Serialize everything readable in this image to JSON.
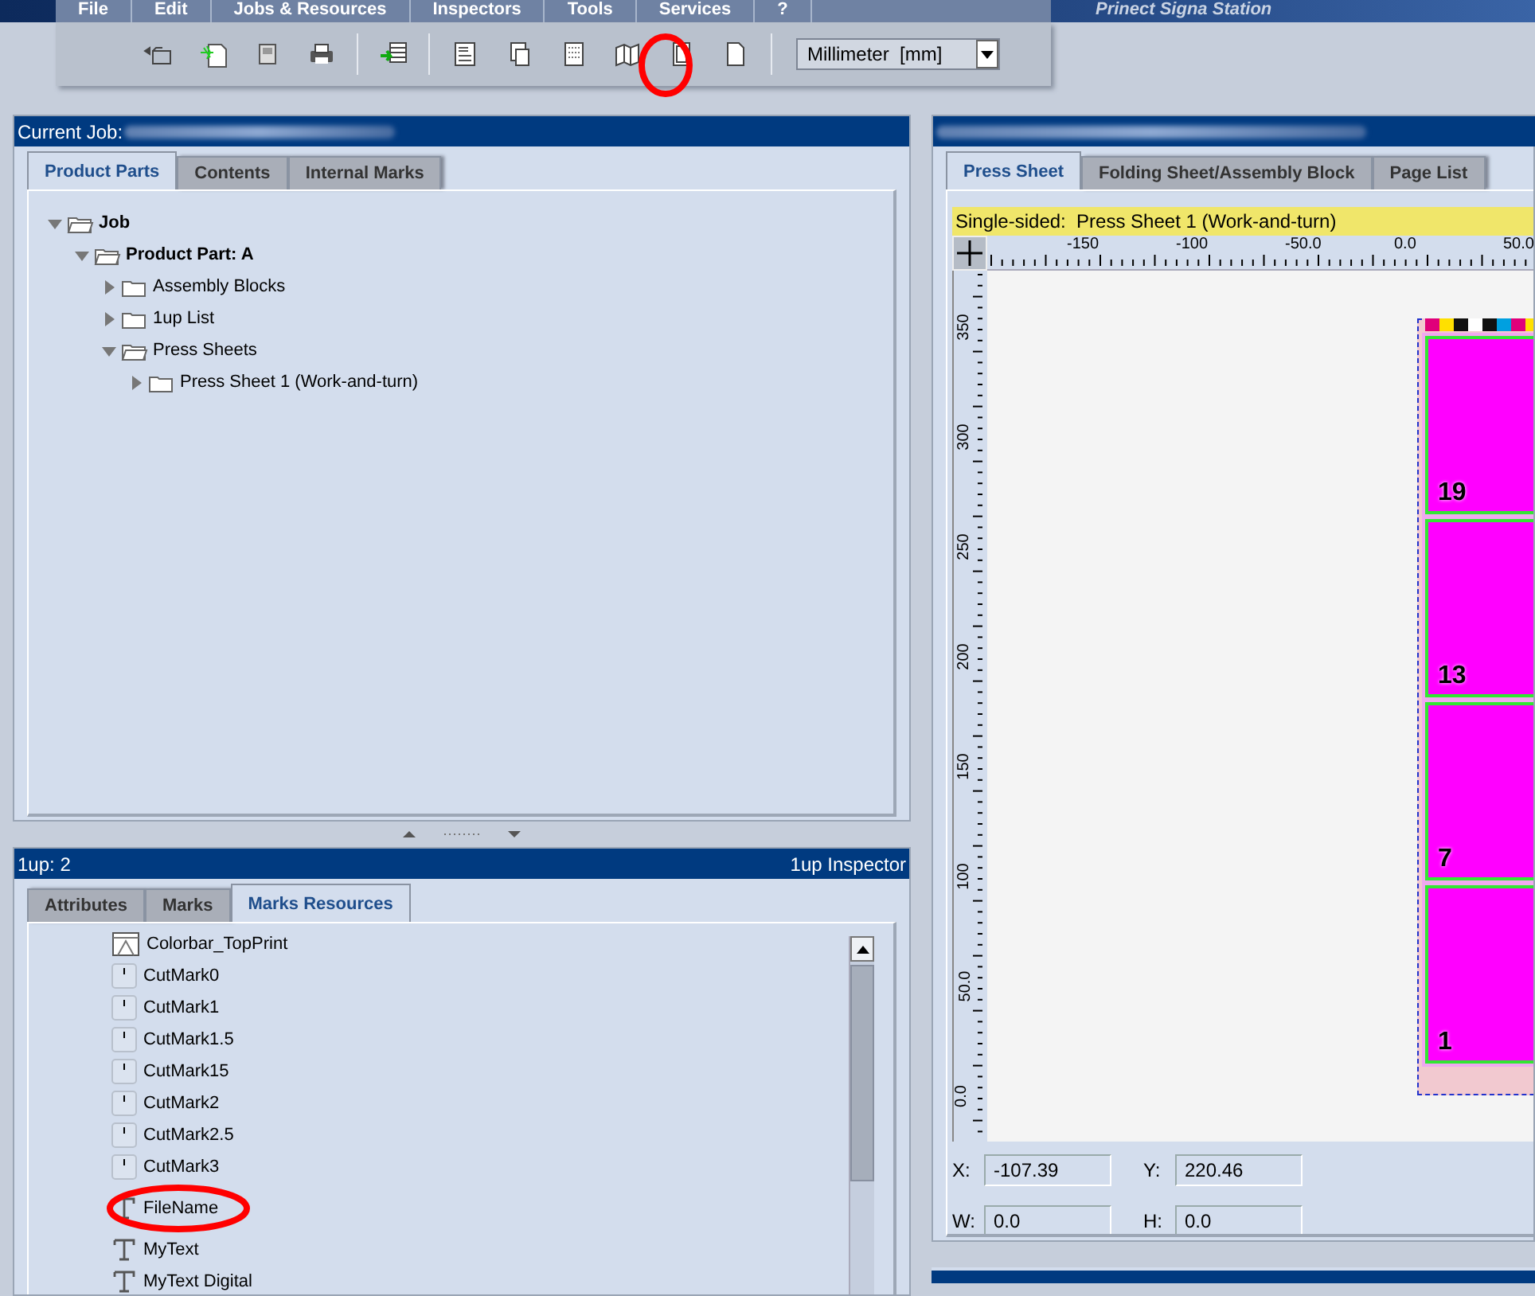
{
  "menu": [
    "File",
    "Edit",
    "Jobs & Resources",
    "Inspectors",
    "Tools",
    "Services",
    "?"
  ],
  "app_title": "Prinect Signa Station",
  "unit_select": {
    "value": "Millimeter  [mm]"
  },
  "job_panel": {
    "title": "Current Job:",
    "tabs": [
      {
        "label": "Product Parts",
        "selected": true
      },
      {
        "label": "Contents",
        "selected": false
      },
      {
        "label": "Internal Marks",
        "selected": false
      }
    ],
    "tree": [
      {
        "label": "Job",
        "kind": "node",
        "expanded": true,
        "children": [
          {
            "label": "Product Part: A",
            "kind": "node",
            "expanded": true,
            "children": [
              {
                "label": "Assembly Blocks",
                "kind": "folder",
                "expanded": false
              },
              {
                "label": "1up List",
                "kind": "folder",
                "expanded": false
              },
              {
                "label": "Press Sheets",
                "kind": "folder",
                "expanded": true,
                "children": [
                  {
                    "label": "Press Sheet 1 (Work-and-turn)",
                    "kind": "folder",
                    "expanded": false
                  }
                ]
              }
            ]
          }
        ]
      }
    ]
  },
  "inspector_panel": {
    "title": "1up: 2",
    "title_right": "1up Inspector",
    "tabs": [
      {
        "label": "Attributes",
        "selected": false
      },
      {
        "label": "Marks",
        "selected": false
      },
      {
        "label": "Marks Resources",
        "selected": true
      }
    ],
    "items": [
      {
        "kind": "colorbar",
        "label": "Colorbar_TopPrint"
      },
      {
        "kind": "cutmark",
        "label": "CutMark0"
      },
      {
        "kind": "cutmark",
        "label": "CutMark1"
      },
      {
        "kind": "cutmark",
        "label": "CutMark1.5"
      },
      {
        "kind": "cutmark",
        "label": "CutMark15"
      },
      {
        "kind": "cutmark",
        "label": "CutMark2"
      },
      {
        "kind": "cutmark",
        "label": "CutMark2.5"
      },
      {
        "kind": "cutmark",
        "label": "CutMark3"
      },
      {
        "kind": "text",
        "label": "FileName"
      },
      {
        "kind": "text",
        "label": "MyText"
      },
      {
        "kind": "text",
        "label": "MyText Digital"
      }
    ]
  },
  "sheet_panel": {
    "tabs": [
      {
        "label": "Press Sheet",
        "selected": true
      },
      {
        "label": "Folding Sheet/Assembly Block",
        "selected": false
      },
      {
        "label": "Page List",
        "selected": false
      }
    ],
    "status": "Single-sided:  Press Sheet 1 (Work-and-turn)",
    "x_ruler": [
      "-150",
      "-100",
      "-50.0",
      "0.0",
      "50.0"
    ],
    "y_ruler": [
      "350",
      "300",
      "250",
      "200",
      "150",
      "100",
      "50.0",
      "0.0"
    ],
    "pages": [
      "19",
      "13",
      "7",
      "1"
    ],
    "coords": [
      {
        "label": "X:",
        "value": "-107.39"
      },
      {
        "label": "Y:",
        "value": "220.46"
      },
      {
        "label": "W:",
        "value": "0.0"
      },
      {
        "label": "H:",
        "value": "0.0"
      }
    ]
  }
}
